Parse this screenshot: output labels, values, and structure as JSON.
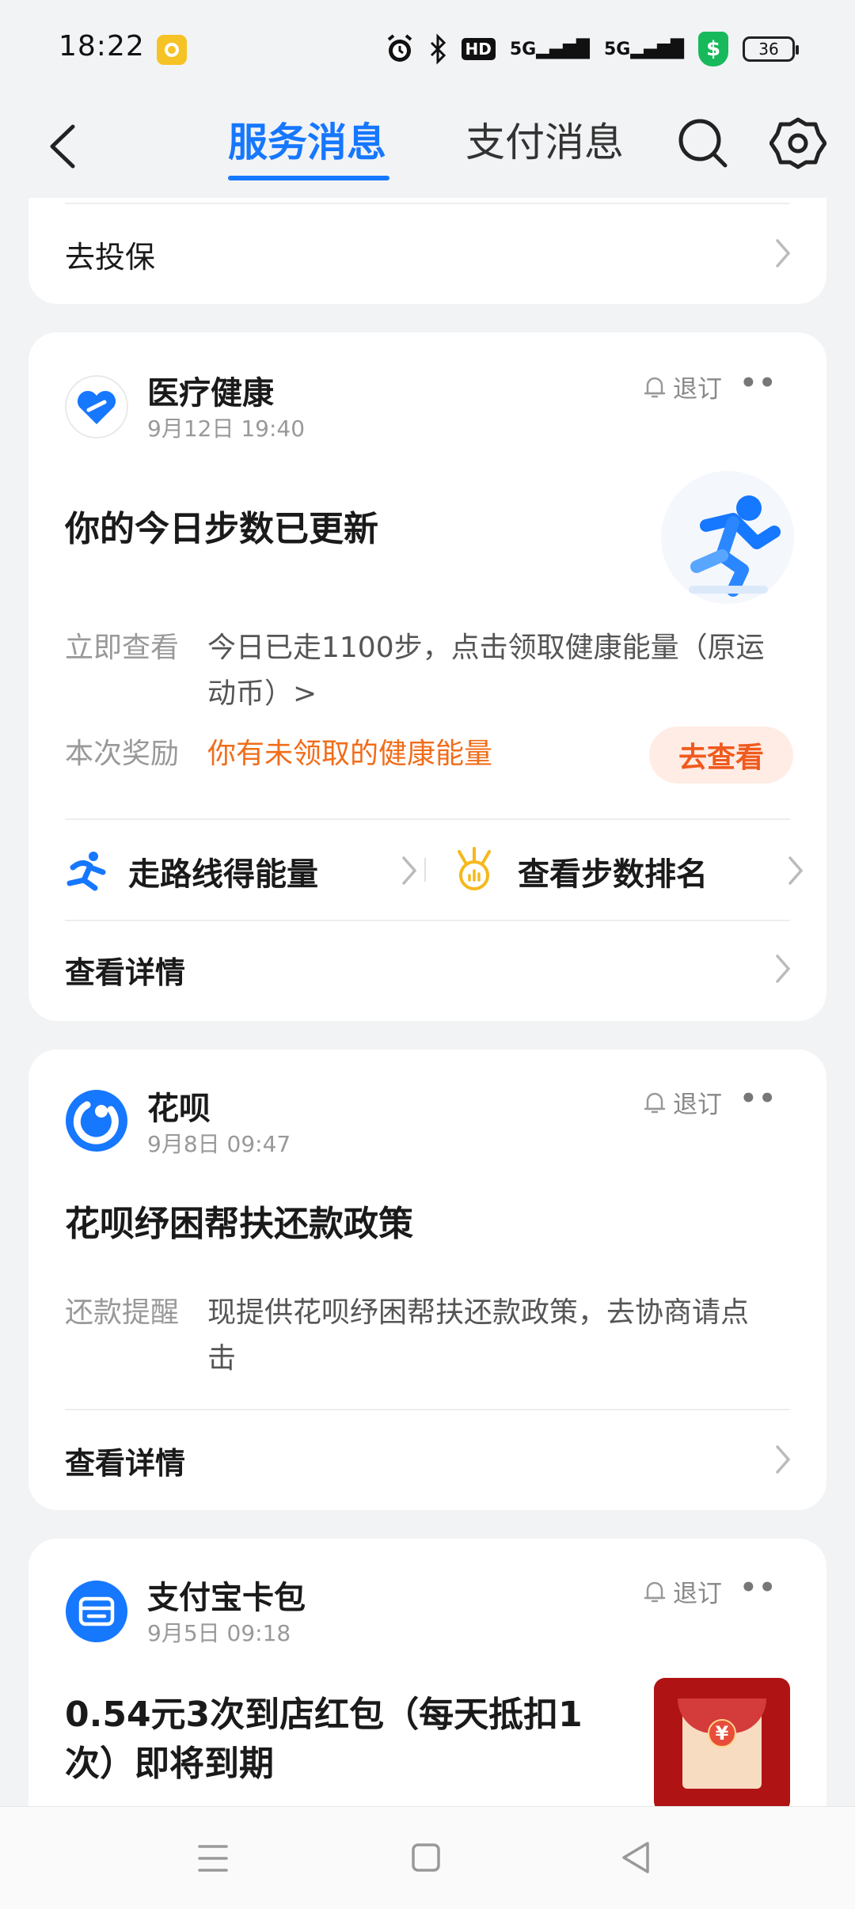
{
  "status_bar": {
    "time": "18:22",
    "hd_label": "HD",
    "signal1": "5G",
    "signal2": "5G",
    "shield_symbol": "$",
    "battery": "36"
  },
  "nav": {
    "tab_service": "服务消息",
    "tab_payment": "支付消息",
    "accent_color": "#1677ff"
  },
  "top_card": {
    "link_label": "去投保"
  },
  "health_card": {
    "service_name": "医疗健康",
    "date": "9月12日 19:40",
    "unsubscribe": "退订",
    "title": "你的今日步数已更新",
    "row1_label": "立即查看",
    "row1_value_line1": "今日已走1100步，点击领取健康能量（原运",
    "row1_value_line2": "动币）>",
    "row2_label": "本次奖励",
    "row2_value": "你有未领取的健康能量",
    "go_button": "去查看",
    "action1": "走路线得能量",
    "action2": "查看步数排名",
    "details": "查看详情"
  },
  "huabei_card": {
    "service_name": "花呗",
    "date": "9月8日 09:47",
    "unsubscribe": "退订",
    "title": "花呗纾困帮扶还款政策",
    "row_label": "还款提醒",
    "row_value_line1": "现提供花呗纾困帮扶还款政策，去协商请点",
    "row_value_line2": "击",
    "details": "查看详情"
  },
  "cardpack_card": {
    "service_name": "支付宝卡包",
    "date": "9月5日 09:18",
    "unsubscribe": "退订",
    "title_line1": "0.54元3次到店红包（每天抵扣1",
    "title_line2": "次）即将到期",
    "envelope_symbol": "¥"
  }
}
